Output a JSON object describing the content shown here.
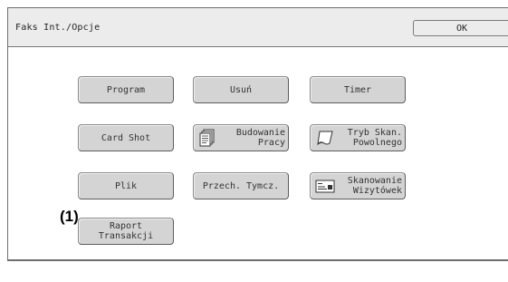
{
  "window": {
    "title": "Faks Int./Opcje",
    "ok_label": "OK"
  },
  "buttons": {
    "program": "Program",
    "usun": "Usuń",
    "timer": "Timer",
    "card_shot": "Card Shot",
    "budowanie_pracy": "Budowanie\nPracy",
    "tryb_skan": "Tryb Skan.\nPowolnego",
    "plik": "Plik",
    "przech": "Przech. Tymcz.",
    "skanowanie": "Skanowanie\nWizytówek",
    "raport": "Raport\nTransakcji"
  },
  "callout_label": "(1)",
  "icons": {
    "budowanie_pracy": "document-stack-icon",
    "tryb_skan": "curled-paper-icon",
    "skanowanie": "business-card-icon"
  }
}
